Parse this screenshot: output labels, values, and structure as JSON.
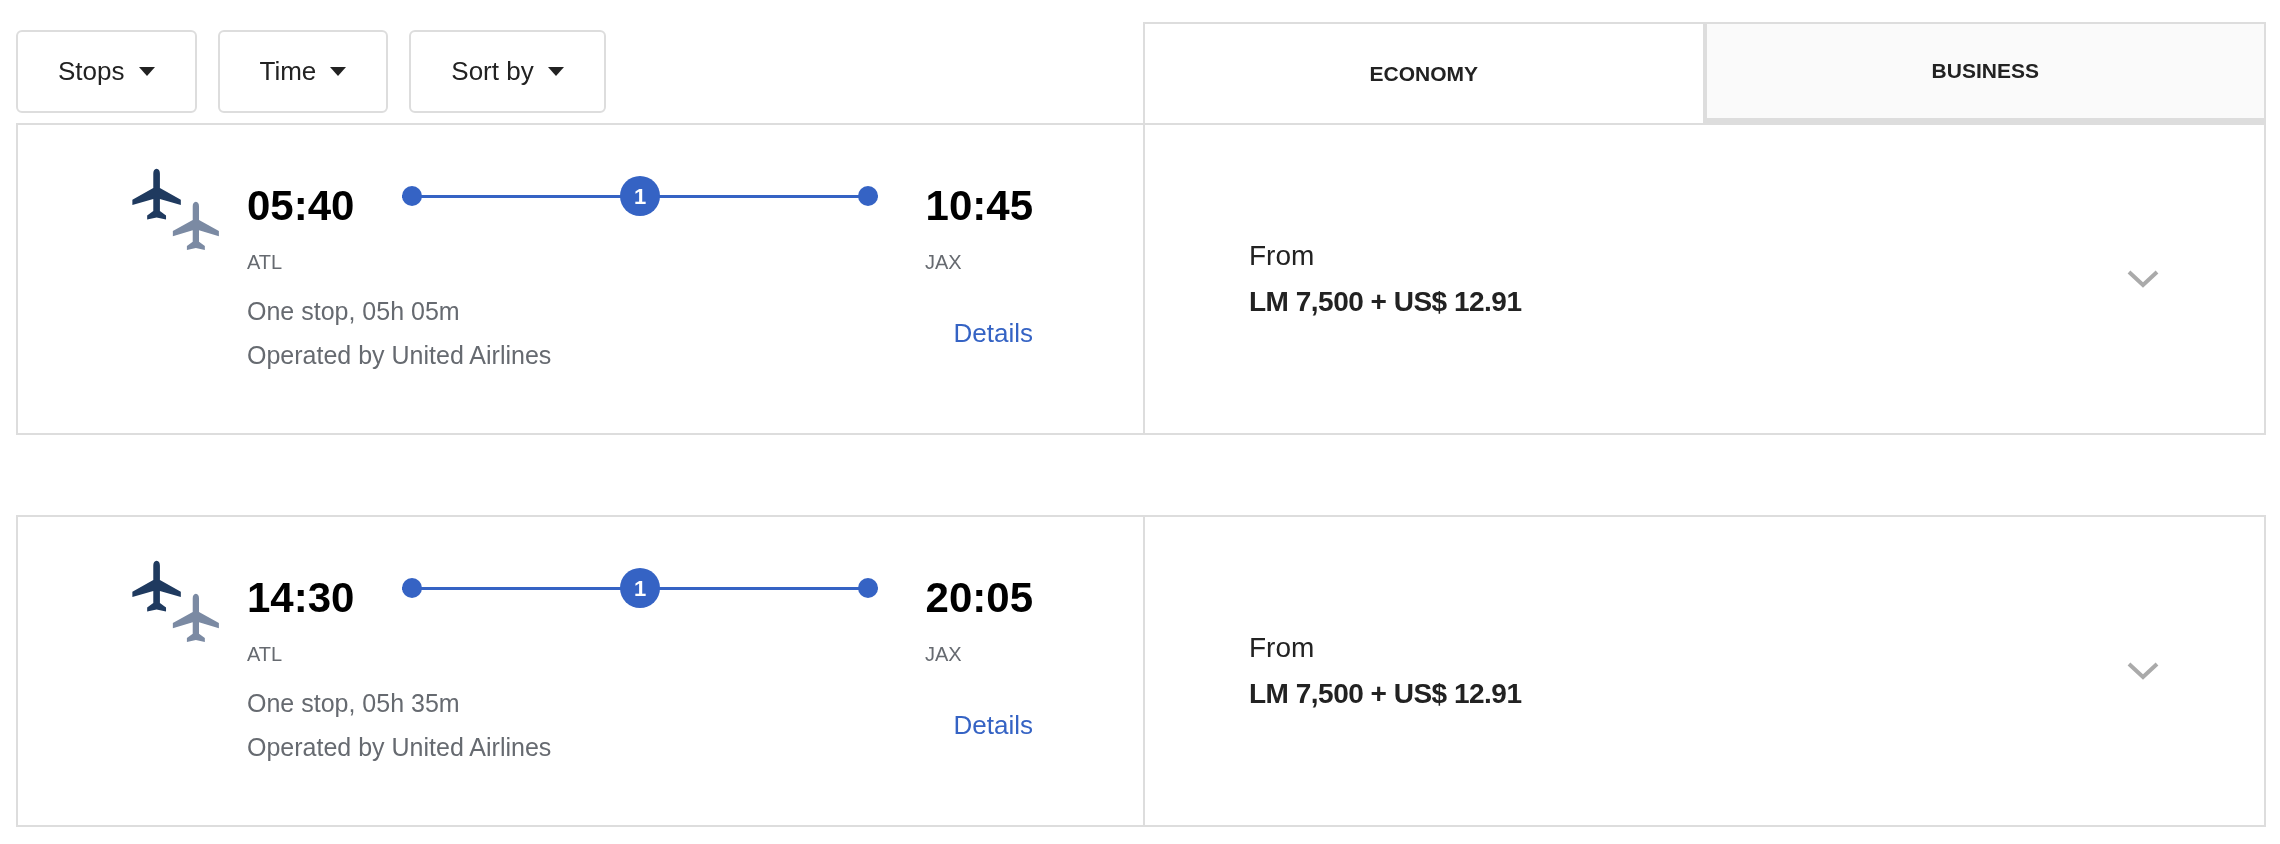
{
  "filters": [
    {
      "label": "Stops"
    },
    {
      "label": "Time"
    },
    {
      "label": "Sort by"
    }
  ],
  "cabin_tabs": [
    {
      "label": "ECONOMY",
      "selected": true
    },
    {
      "label": "BUSINESS",
      "selected": false
    }
  ],
  "flights": [
    {
      "departure_time": "05:40",
      "departure_airport": "ATL",
      "stops_badge": "1",
      "arrival_time": "10:45",
      "arrival_airport": "JAX",
      "summary": "One stop, 05h 05m",
      "operator": "Operated by United Airlines",
      "details_link": "Details",
      "price_label": "From",
      "price": "LM 7,500 + US$ 12.91",
      "expanded": false
    },
    {
      "departure_time": "14:30",
      "departure_airport": "ATL",
      "stops_badge": "1",
      "arrival_time": "20:05",
      "arrival_airport": "JAX",
      "summary": "One stop, 05h 35m",
      "operator": "Operated by United Airlines",
      "details_link": "Details",
      "price_label": "From",
      "price": "LM 7,500 + US$ 12.91",
      "expanded": false
    }
  ]
}
